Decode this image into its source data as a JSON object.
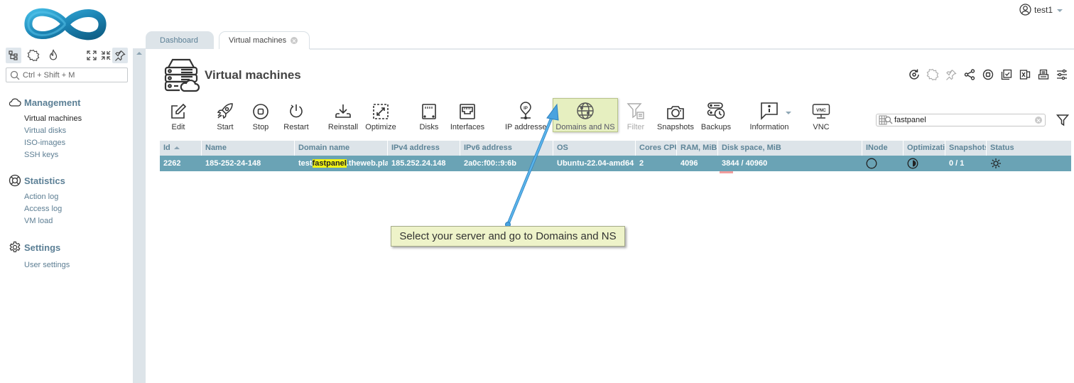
{
  "user": {
    "name": "test1",
    "icon": "user-circle-icon"
  },
  "sidebar": {
    "search_placeholder": "Ctrl + Shift + M",
    "tools": [
      "tree-icon",
      "puzzle-icon",
      "flame-icon",
      "expand-icon",
      "collapse-icon",
      "pin-icon"
    ],
    "groups": [
      {
        "label": "Management",
        "icon": "cloud-icon",
        "items": [
          {
            "label": "Virtual machines",
            "active": true
          },
          {
            "label": "Virtual disks"
          },
          {
            "label": "ISO-images"
          },
          {
            "label": "SSH keys"
          }
        ]
      },
      {
        "label": "Statistics",
        "icon": "lifebuoy-icon",
        "items": [
          {
            "label": "Action log"
          },
          {
            "label": "Access log"
          },
          {
            "label": "VM load"
          }
        ]
      },
      {
        "label": "Settings",
        "icon": "gear-icon",
        "items": [
          {
            "label": "User settings"
          }
        ]
      }
    ]
  },
  "tabs": [
    {
      "label": "Dashboard"
    },
    {
      "label": "Virtual machines",
      "active": true,
      "closable": true
    }
  ],
  "page": {
    "title": "Virtual machines",
    "tools": [
      "refresh-icon",
      "puzzle-icon",
      "pin-icon",
      "share-icon",
      "stop-circle-icon",
      "checkbox-copy-icon",
      "excel-icon",
      "print-icon",
      "settings-sliders-icon"
    ]
  },
  "toolbar": [
    {
      "label": "Edit",
      "icon": "edit-icon"
    },
    {
      "label": "Start",
      "icon": "rocket-icon"
    },
    {
      "label": "Stop",
      "icon": "stop-icon"
    },
    {
      "label": "Restart",
      "icon": "restart-icon"
    },
    {
      "label": "Reinstall",
      "icon": "reinstall-icon"
    },
    {
      "label": "Optimize",
      "icon": "optimize-icon"
    },
    {
      "label": "Disks",
      "icon": "disk-icon"
    },
    {
      "label": "Interfaces",
      "icon": "ethernet-icon"
    },
    {
      "label": "IP addresses",
      "icon": "ip-pin-icon"
    },
    {
      "label": "Domains and NS",
      "icon": "globe-icon",
      "highlighted": true
    },
    {
      "label": "Filter",
      "icon": "filter-icon",
      "disabled": true
    },
    {
      "label": "Snapshots",
      "icon": "camera-icon"
    },
    {
      "label": "Backups",
      "icon": "backup-icon"
    },
    {
      "label": "Information",
      "icon": "info-bubble-icon",
      "dropdown": true
    },
    {
      "label": "VNC",
      "icon": "vnc-monitor-icon"
    }
  ],
  "search": {
    "value": "fastpanel"
  },
  "table": {
    "columns": [
      "Id",
      "Name",
      "Domain name",
      "IPv4 address",
      "IPv6 address",
      "OS",
      "Cores CPU",
      "RAM, MiB",
      "Disk space, MiB",
      "INode",
      "Optimization",
      "Snapshots",
      "Status"
    ],
    "sort_column": "Id",
    "sort_dir": "asc",
    "rows": [
      {
        "id": "2262",
        "name": "185-252-24-148",
        "domain_prefix": "test",
        "domain_match": "fastpanel",
        "domain_suffix": ".theweb.place",
        "ipv4": "185.252.24.148",
        "ipv6": "2a0c:f00::9:6b",
        "os": "Ubuntu-22.04-amd64",
        "cores": "2",
        "ram": "4096",
        "disk": "3844 / 40960",
        "disk_used_fraction": 0.094,
        "inode": "empty-circle-icon",
        "optimization": "half-circle-icon",
        "snapshots": "0 / 1",
        "status": "sun-icon"
      }
    ]
  },
  "callout": {
    "text": "Select your server and go to Domains and NS",
    "color": "#4aa3df"
  }
}
